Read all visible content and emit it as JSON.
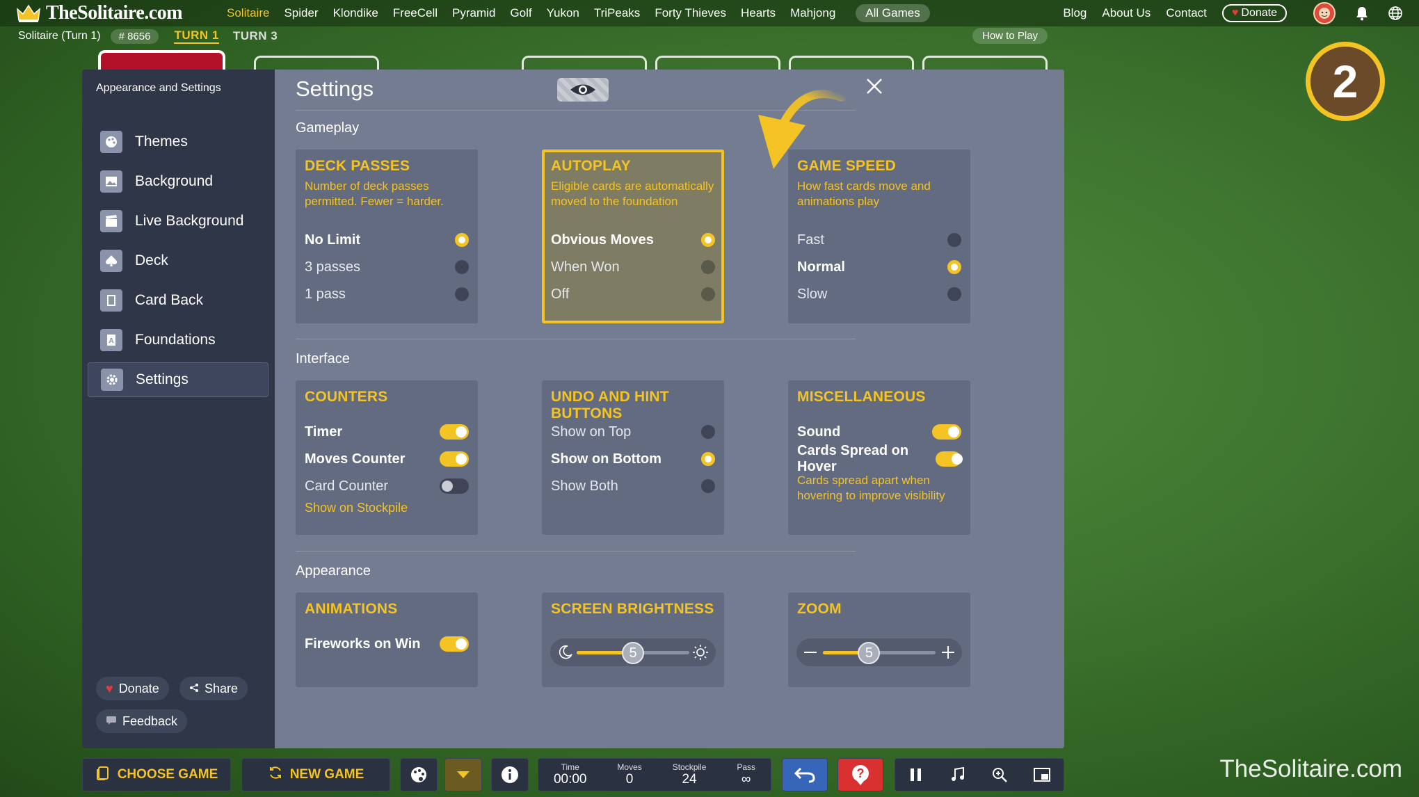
{
  "site": {
    "brand": "TheSolitaire.com",
    "nav": [
      "Solitaire",
      "Spider",
      "Klondike",
      "FreeCell",
      "Pyramid",
      "Golf",
      "Yukon",
      "TriPeaks",
      "Forty Thieves",
      "Hearts",
      "Mahjong"
    ],
    "active_nav": "Solitaire",
    "all_games": "All Games",
    "right_links": [
      "Blog",
      "About Us",
      "Contact"
    ],
    "donate": "Donate"
  },
  "game": {
    "label": "Solitaire (Turn 1)",
    "number": "# 8656",
    "turn_active": "TURN 1",
    "turn_other": "TURN 3",
    "how_to_play": "How to Play",
    "step_badge": "2"
  },
  "sidebar": {
    "title": "Appearance and Settings",
    "items": [
      {
        "label": "Themes",
        "icon": "palette-icon"
      },
      {
        "label": "Background",
        "icon": "image-icon"
      },
      {
        "label": "Live Background",
        "icon": "clapper-icon"
      },
      {
        "label": "Deck",
        "icon": "spade-icon"
      },
      {
        "label": "Card Back",
        "icon": "card-back-icon"
      },
      {
        "label": "Foundations",
        "icon": "foundation-icon"
      },
      {
        "label": "Settings",
        "icon": "gear-icon"
      }
    ],
    "selected": "Settings",
    "donate": "Donate",
    "share": "Share",
    "feedback": "Feedback"
  },
  "settings": {
    "title": "Settings",
    "sections": {
      "gameplay": "Gameplay",
      "interface": "Interface",
      "appearance": "Appearance"
    },
    "deck_passes": {
      "title": "DECK PASSES",
      "desc": "Number of deck passes permitted. Fewer = harder.",
      "options": [
        "No Limit",
        "3 passes",
        "1 pass"
      ],
      "selected": "No Limit"
    },
    "autoplay": {
      "title": "AUTOPLAY",
      "desc": "Eligible cards are automatically moved to the foundation",
      "options": [
        "Obvious Moves",
        "When Won",
        "Off"
      ],
      "selected": "Obvious Moves"
    },
    "game_speed": {
      "title": "GAME SPEED",
      "desc": "How fast cards move and animations play",
      "options": [
        "Fast",
        "Normal",
        "Slow"
      ],
      "selected": "Normal"
    },
    "counters": {
      "title": "COUNTERS",
      "options": [
        {
          "label": "Timer",
          "on": true
        },
        {
          "label": "Moves Counter",
          "on": true
        },
        {
          "label": "Card Counter",
          "on": false
        }
      ],
      "sub": "Show on Stockpile"
    },
    "undo_hint": {
      "title": "UNDO AND HINT BUTTONS",
      "options": [
        "Show on Top",
        "Show on Bottom",
        "Show Both"
      ],
      "selected": "Show on Bottom"
    },
    "misc": {
      "title": "MISCELLANEOUS",
      "options": [
        {
          "label": "Sound",
          "on": true
        },
        {
          "label": "Cards Spread on Hover",
          "on": true
        }
      ],
      "desc": "Cards spread apart when hovering to improve visibility"
    },
    "animations": {
      "title": "ANIMATIONS",
      "options": [
        {
          "label": "Fireworks on Win",
          "on": true
        }
      ]
    },
    "brightness": {
      "title": "SCREEN BRIGHTNESS",
      "value": "5",
      "level": 0.5
    },
    "zoom": {
      "title": "ZOOM",
      "value": "5",
      "level": 0.41
    }
  },
  "bottom": {
    "choose_game": "CHOOSE GAME",
    "new_game": "NEW GAME",
    "stats": [
      {
        "label": "Time",
        "value": "00:00"
      },
      {
        "label": "Moves",
        "value": "0"
      },
      {
        "label": "Stockpile",
        "value": "24"
      },
      {
        "label": "Pass",
        "value": "∞"
      }
    ],
    "watermark": "TheSolitaire.com"
  },
  "colors": {
    "accent": "#f4c324",
    "panel": "#636b80",
    "modal": "#737c91",
    "sidebar": "#2f3648"
  }
}
